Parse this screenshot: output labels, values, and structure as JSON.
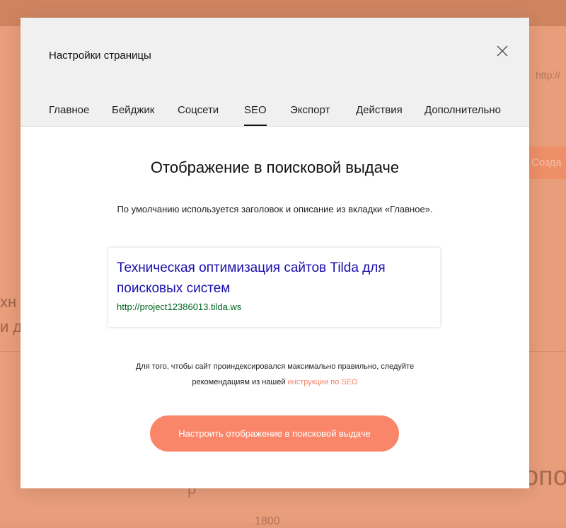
{
  "background": {
    "url_fragment": "http://",
    "create_button_fragment": "Созда",
    "text_fragment_1": "хн",
    "text_fragment_2": "и д",
    "text_fragment_3": "опо",
    "text_fragment_4": "р",
    "text_fragment_5": "1800"
  },
  "modal": {
    "title": "Настройки страницы",
    "tabs": [
      {
        "label": "Главное",
        "active": false
      },
      {
        "label": "Бейджик",
        "active": false
      },
      {
        "label": "Соцсети",
        "active": false
      },
      {
        "label": "SEO",
        "active": true
      },
      {
        "label": "Экспорт",
        "active": false
      },
      {
        "label": "Действия",
        "active": false
      },
      {
        "label": "Дополнительно",
        "active": false
      }
    ],
    "section_title": "Отображение в поисковой выдаче",
    "section_description": "По умолчанию используется заголовок и описание из вкладки «Главное».",
    "snippet": {
      "title": "Техническая оптимизация сайтов Tilda для поисковых систем",
      "url": "http://project12386013.tilda.ws"
    },
    "hint_line_1": "Для того, чтобы сайт проиндексировался максимально правильно, следуйте",
    "hint_line_2_prefix": "рекомендациям из нашей ",
    "hint_link": "инструкции по SEO",
    "primary_button": "Настроить отображение в поисковой выдаче"
  },
  "colors": {
    "accent": "#fa8669",
    "link": "#f4846a",
    "snippet_title": "#1a0dab",
    "snippet_url": "#006621",
    "header_bg": "#f0f0f0"
  },
  "icons": {
    "close": "close-icon"
  }
}
